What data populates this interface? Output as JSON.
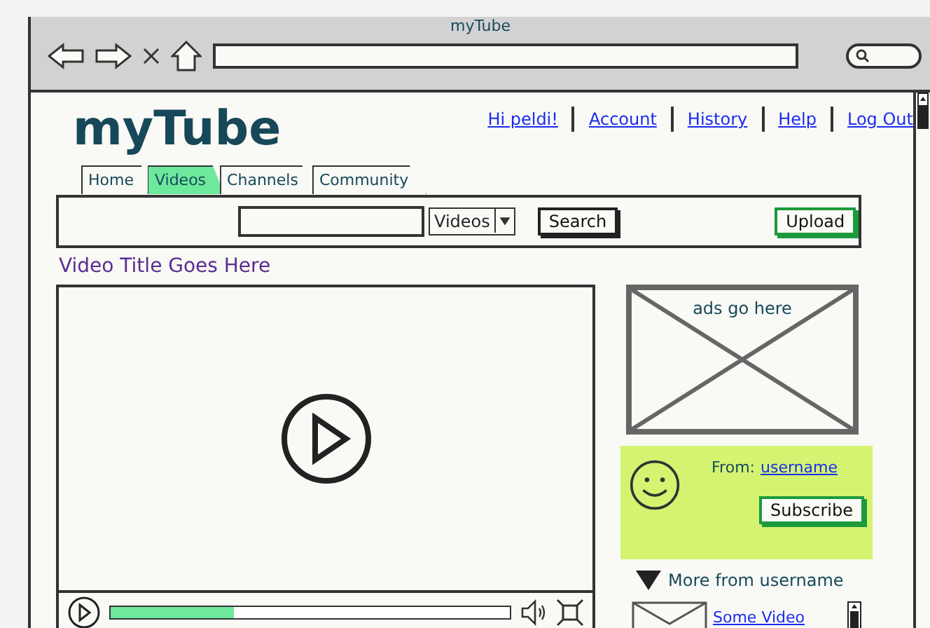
{
  "browser": {
    "title": "myTube"
  },
  "site": {
    "logo": "myTube",
    "user_links": [
      {
        "label": "Hi peldi!"
      },
      {
        "label": "Account"
      },
      {
        "label": "History"
      },
      {
        "label": "Help"
      },
      {
        "label": "Log Out"
      }
    ],
    "tabs": [
      {
        "label": "Home",
        "selected": false
      },
      {
        "label": "Videos",
        "selected": true
      },
      {
        "label": "Channels",
        "selected": false
      },
      {
        "label": "Community",
        "selected": false
      }
    ],
    "search": {
      "category": "Videos",
      "button": "Search"
    },
    "upload": "Upload"
  },
  "video": {
    "title": "Video Title Goes Here",
    "progress": {
      "level": 0.31
    }
  },
  "ad": {
    "text": "ads go here"
  },
  "uploader": {
    "from_label": "From:",
    "username": "username",
    "subscribe": "Subscribe"
  },
  "related": {
    "heading": "More from username",
    "expanded": true,
    "items": [
      {
        "title": "Some Video"
      }
    ]
  }
}
